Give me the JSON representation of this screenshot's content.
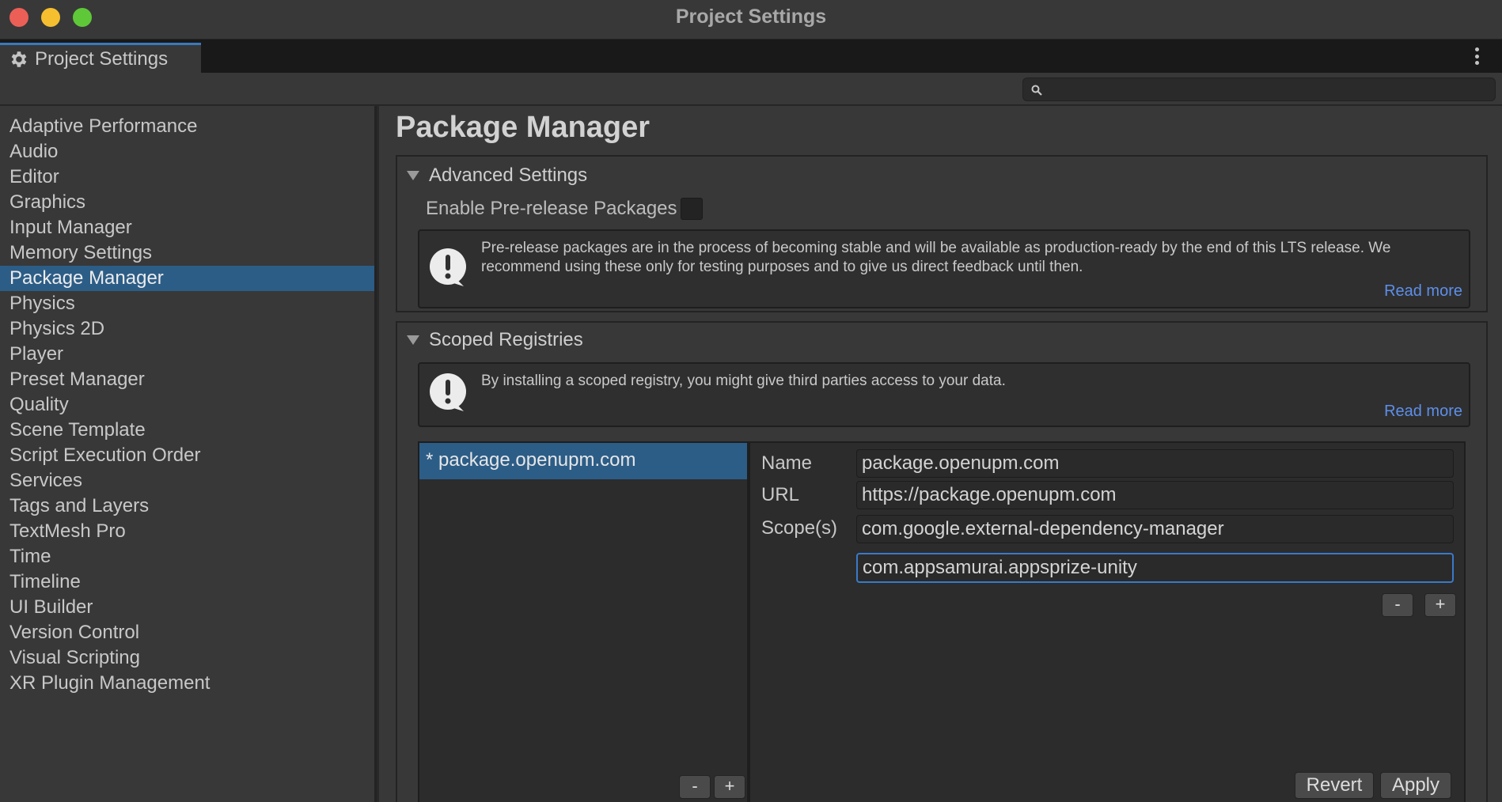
{
  "window": {
    "title": "Project Settings"
  },
  "tab": {
    "label": "Project Settings",
    "icon": "gear-icon"
  },
  "search": {
    "value": "",
    "placeholder": ""
  },
  "sidebar": {
    "items": [
      {
        "label": "Adaptive Performance",
        "selected": false
      },
      {
        "label": "Audio",
        "selected": false
      },
      {
        "label": "Editor",
        "selected": false
      },
      {
        "label": "Graphics",
        "selected": false
      },
      {
        "label": "Input Manager",
        "selected": false
      },
      {
        "label": "Memory Settings",
        "selected": false
      },
      {
        "label": "Package Manager",
        "selected": true
      },
      {
        "label": "Physics",
        "selected": false
      },
      {
        "label": "Physics 2D",
        "selected": false
      },
      {
        "label": "Player",
        "selected": false
      },
      {
        "label": "Preset Manager",
        "selected": false
      },
      {
        "label": "Quality",
        "selected": false
      },
      {
        "label": "Scene Template",
        "selected": false
      },
      {
        "label": "Script Execution Order",
        "selected": false
      },
      {
        "label": "Services",
        "selected": false
      },
      {
        "label": "Tags and Layers",
        "selected": false
      },
      {
        "label": "TextMesh Pro",
        "selected": false
      },
      {
        "label": "Time",
        "selected": false
      },
      {
        "label": "Timeline",
        "selected": false
      },
      {
        "label": "UI Builder",
        "selected": false
      },
      {
        "label": "Version Control",
        "selected": false
      },
      {
        "label": "Visual Scripting",
        "selected": false
      },
      {
        "label": "XR Plugin Management",
        "selected": false
      }
    ]
  },
  "main": {
    "title": "Package Manager",
    "advanced": {
      "header": "Advanced Settings",
      "prerelease_label": "Enable Pre-release Packages",
      "prerelease_checked": false,
      "help_text": "Pre-release packages are in the process of becoming stable and will be available as production-ready by the end of this LTS release. We recommend using these only for testing purposes and to give us direct feedback until then.",
      "read_more": "Read more"
    },
    "scoped": {
      "header": "Scoped Registries",
      "help_text": "By installing a scoped registry, you might give third parties access to your data.",
      "read_more": "Read more",
      "registries": [
        {
          "label": "* package.openupm.com"
        }
      ],
      "list_minus": "-",
      "list_plus": "+",
      "name_label": "Name",
      "name_value": "package.openupm.com",
      "url_label": "URL",
      "url_value": "https://package.openupm.com",
      "scopes_label": "Scope(s)",
      "scopes": [
        "com.google.external-dependency-manager",
        "com.appsamurai.appsprize-unity"
      ],
      "scope_minus": "-",
      "scope_plus": "+",
      "revert": "Revert",
      "apply": "Apply"
    }
  },
  "colors": {
    "accent": "#3a79c9",
    "selection": "#2c5d87",
    "link": "#5d8fea"
  }
}
